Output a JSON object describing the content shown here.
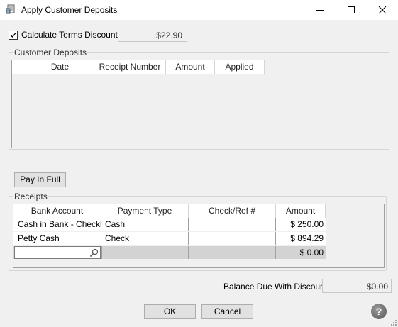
{
  "window": {
    "title": "Apply Customer Deposits"
  },
  "discount": {
    "checkbox_label": "Calculate Terms Discount",
    "checked": true,
    "value": "$22.90"
  },
  "deposits": {
    "group_label": "Customer Deposits",
    "columns": [
      "Date",
      "Receipt Number",
      "Amount",
      "Applied"
    ]
  },
  "pay_in_full_label": "Pay In Full",
  "receipts": {
    "group_label": "Receipts",
    "columns": [
      "Bank Account",
      "Payment Type",
      "Check/Ref #",
      "Amount"
    ],
    "rows": [
      {
        "bank_account": "Cash in Bank - Checki",
        "payment_type": "Cash",
        "check_ref": "",
        "amount": "$ 250.00"
      },
      {
        "bank_account": "Petty Cash",
        "payment_type": "Check",
        "check_ref": "",
        "amount": "$ 894.29"
      }
    ],
    "new_row": {
      "amount": "$ 0.00"
    }
  },
  "balance": {
    "label": "Balance Due With Discount",
    "value": "$0.00"
  },
  "buttons": {
    "ok": "OK",
    "cancel": "Cancel"
  },
  "icons": {
    "app": "document-icon",
    "search": "magnifier-icon",
    "help": "question-icon"
  }
}
